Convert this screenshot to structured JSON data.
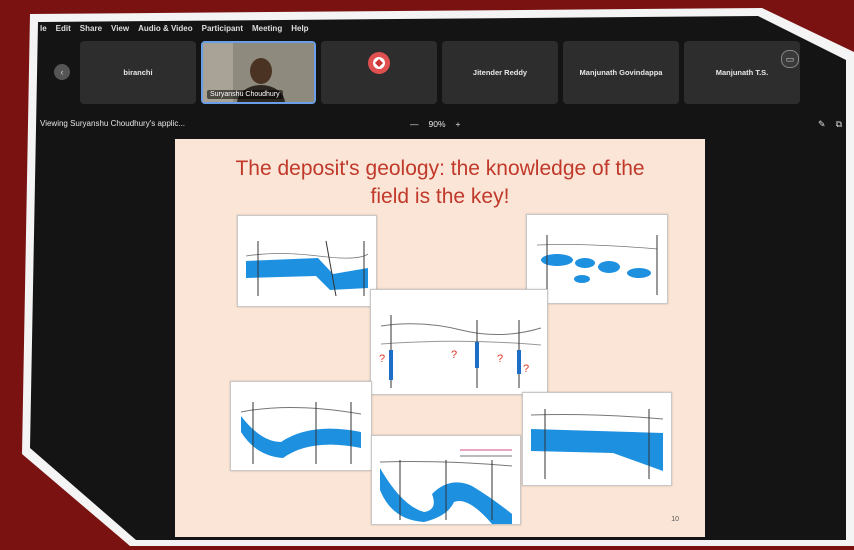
{
  "menu": [
    "le",
    "Edit",
    "Share",
    "View",
    "Audio & Video",
    "Participant",
    "Meeting",
    "Help"
  ],
  "participants": [
    {
      "name": "biranchi"
    },
    {
      "name": "Suryanshu Choudhury"
    },
    {
      "name": ""
    },
    {
      "name": "Jitender Reddy"
    },
    {
      "name": "Manjunath Govindappa"
    },
    {
      "name": "Manjunath T.S."
    }
  ],
  "status": {
    "viewing": "Viewing Suryanshu Choudhury's applic...",
    "zoom_minus": "—",
    "zoom": "90%",
    "zoom_plus": "+"
  },
  "slide": {
    "title_line1": "The deposit's geology: the knowledge of the",
    "title_line2": "field is the key!",
    "page": "10",
    "question_marks": [
      "?",
      "?",
      "?",
      "?"
    ]
  },
  "colors": {
    "frame": "#7a1212",
    "screen": "#121212",
    "accent": "#1e90e0",
    "title": "#c0392b"
  }
}
